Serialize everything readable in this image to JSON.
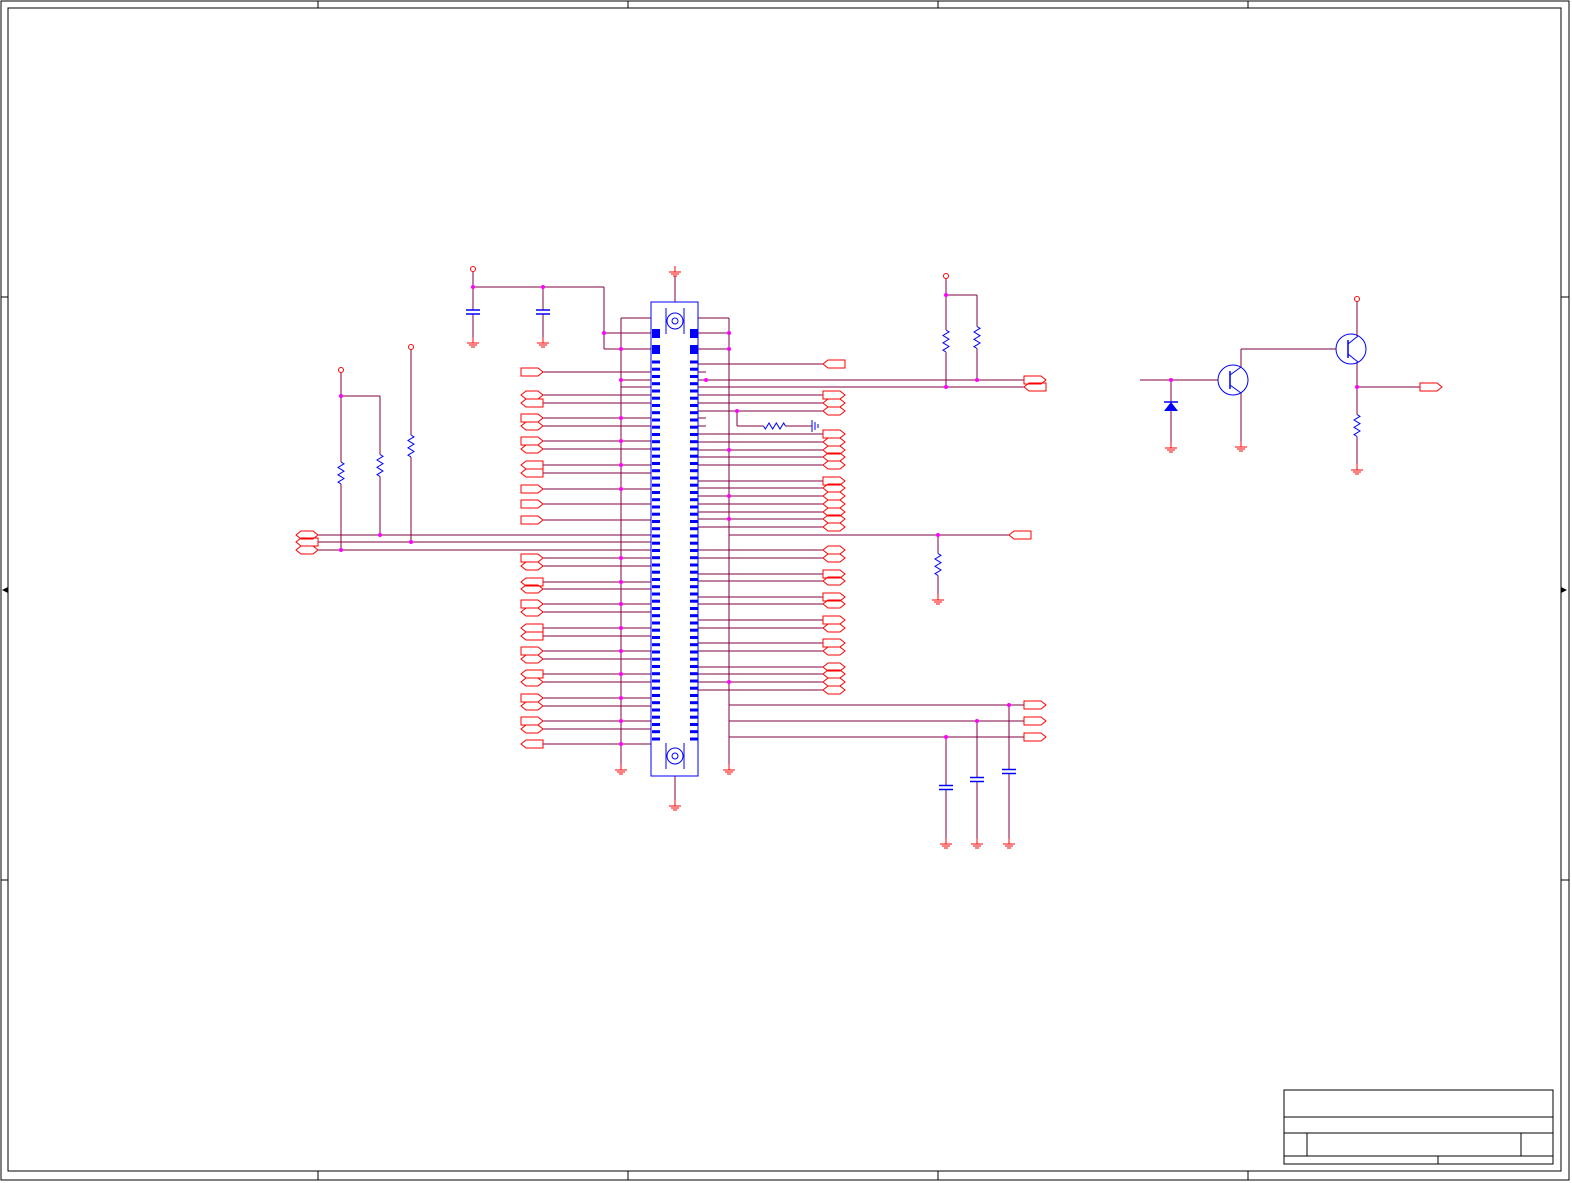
{
  "sheet": {
    "colors": {
      "border": "#000000",
      "wire": "#800040",
      "port": "#ff0000",
      "component": "#0000ff",
      "junction": "#ff00ff",
      "background": "#ffffff"
    },
    "zone_columns": 5,
    "zone_rows": 3
  },
  "components": {
    "connector": {
      "icon": "board-to-board-connector-icon",
      "left_pins": 27,
      "right_pins": 27
    },
    "resistors": {
      "icon": "resistor-zigzag-icon"
    },
    "capacitors": {
      "icon": "capacitor-icon"
    },
    "transistors": {
      "icon": "npn-transistor-icon"
    },
    "diode": {
      "icon": "zener-diode-icon"
    }
  }
}
